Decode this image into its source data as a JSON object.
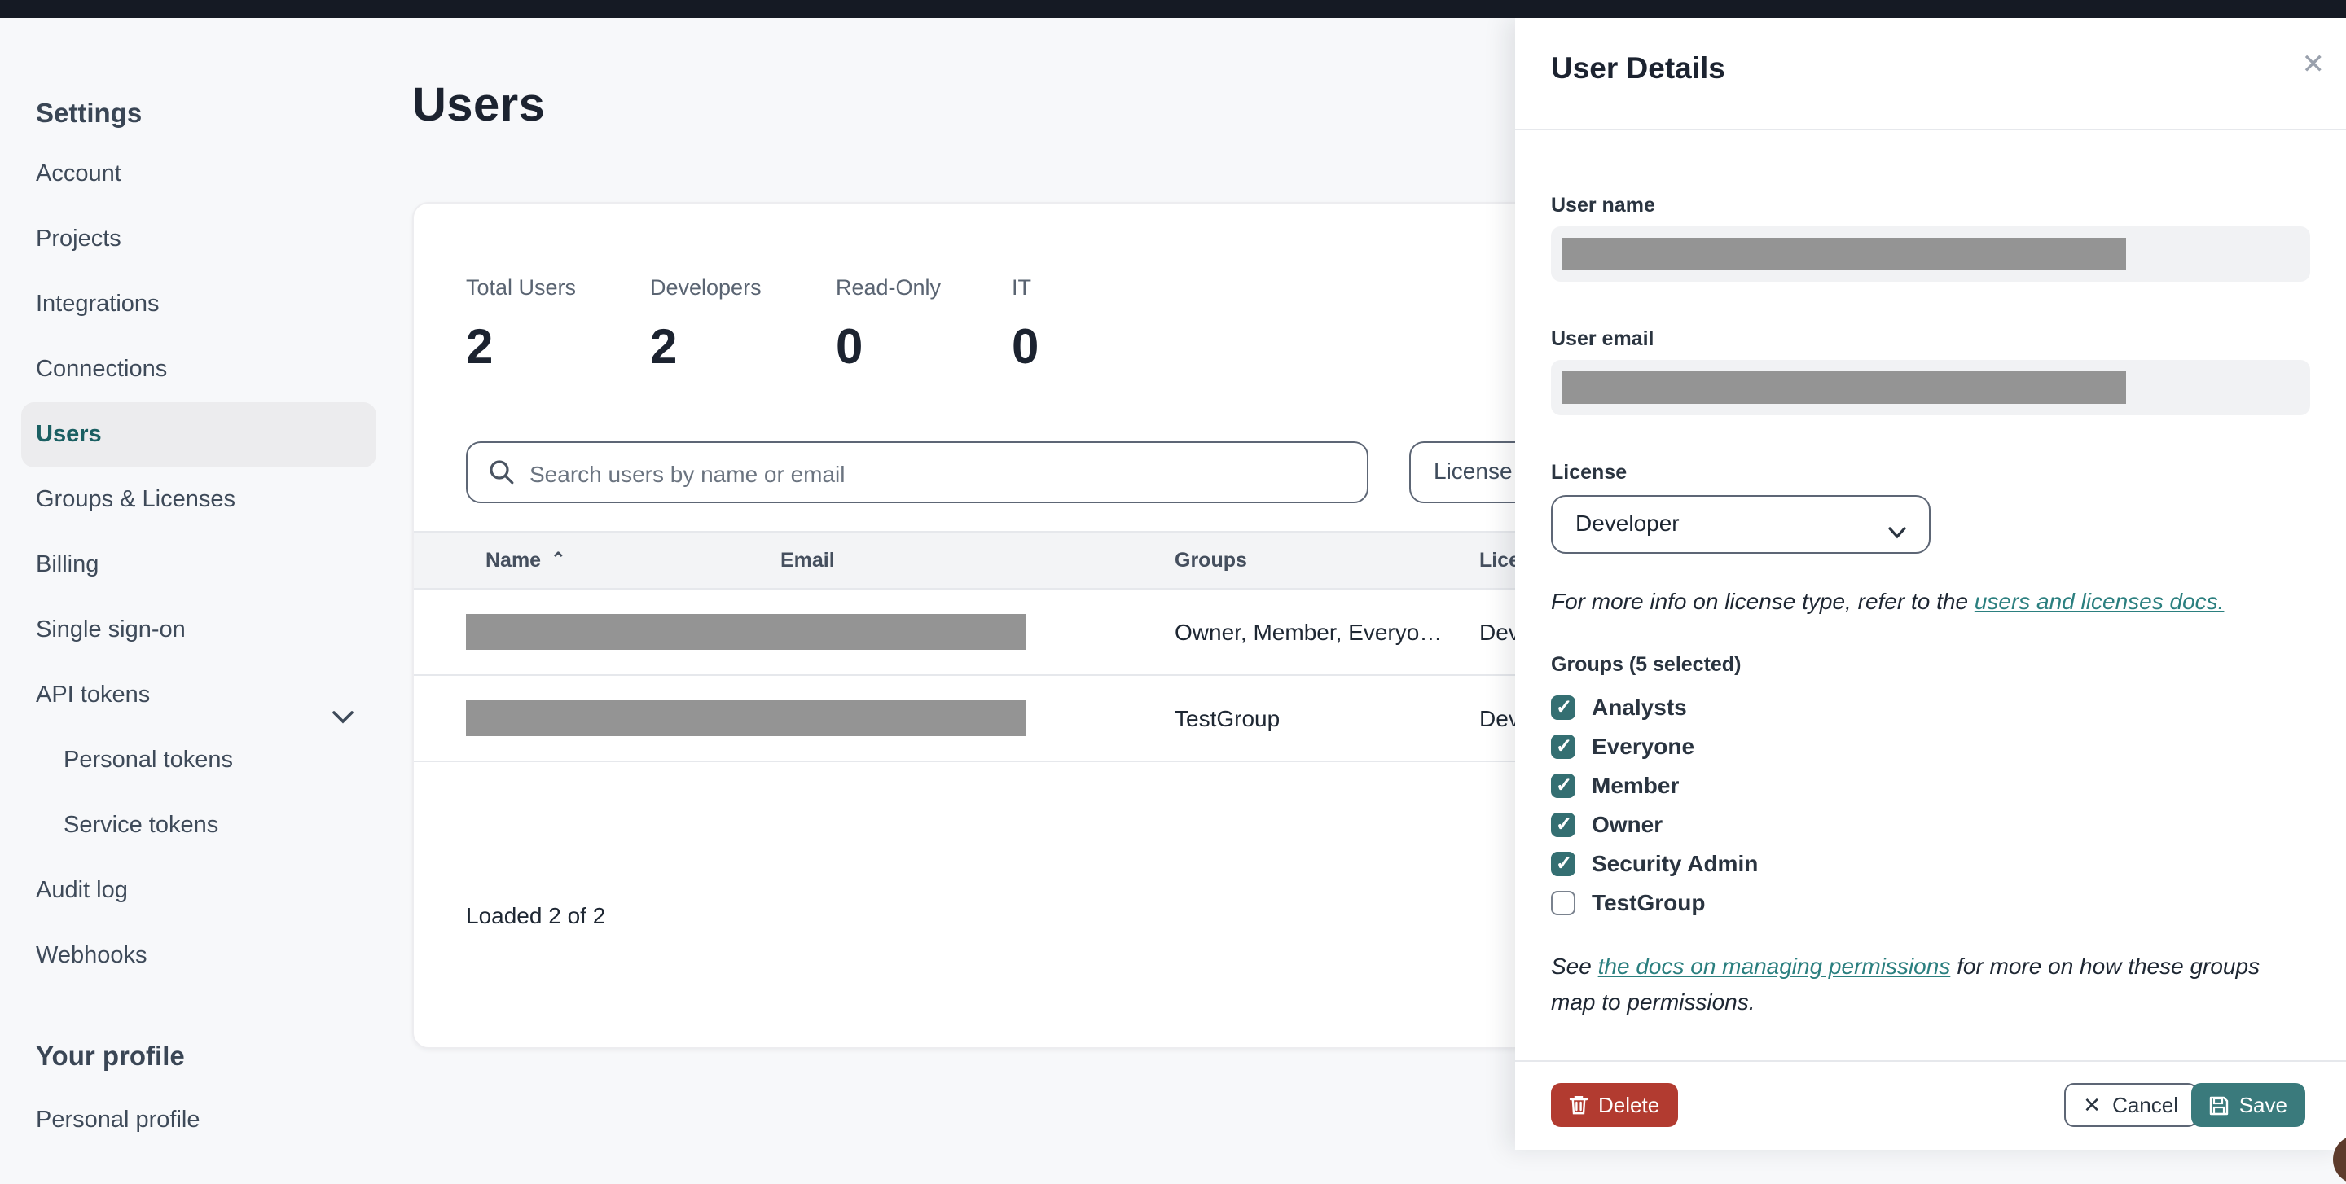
{
  "sidebar": {
    "section_title": "Settings",
    "items": [
      {
        "label": "Account"
      },
      {
        "label": "Projects"
      },
      {
        "label": "Integrations"
      },
      {
        "label": "Connections"
      },
      {
        "label": "Users",
        "active": true
      },
      {
        "label": "Groups & Licenses"
      },
      {
        "label": "Billing"
      },
      {
        "label": "Single sign-on"
      },
      {
        "label": "API tokens",
        "expandable": true
      },
      {
        "label": "Personal tokens",
        "sub": true
      },
      {
        "label": "Service tokens",
        "sub": true
      },
      {
        "label": "Audit log"
      },
      {
        "label": "Webhooks"
      }
    ],
    "profile_section_title": "Your profile",
    "profile_item": "Personal profile"
  },
  "main": {
    "title": "Users",
    "stats": [
      {
        "label": "Total Users",
        "value": "2"
      },
      {
        "label": "Developers",
        "value": "2"
      },
      {
        "label": "Read-Only",
        "value": "0"
      },
      {
        "label": "IT",
        "value": "0"
      }
    ],
    "search_placeholder": "Search users by name or email",
    "license_filter_label": "License",
    "table": {
      "columns": [
        "Name",
        "Email",
        "Groups",
        "License"
      ],
      "rows": [
        {
          "groups": "Owner, Member, Everyo…",
          "license": "Developer"
        },
        {
          "groups": "TestGroup",
          "license": "Developer"
        }
      ]
    },
    "loaded_text": "Loaded 2 of 2"
  },
  "panel": {
    "title": "User Details",
    "user_name_label": "User name",
    "user_email_label": "User email",
    "license_label": "License",
    "license_value": "Developer",
    "license_info": {
      "prefix": "For more info on license type, refer to the ",
      "link": "users and licenses docs."
    },
    "groups": {
      "label": "Groups (5 selected)",
      "options": [
        {
          "label": "Analysts",
          "checked": true
        },
        {
          "label": "Everyone",
          "checked": true
        },
        {
          "label": "Member",
          "checked": true
        },
        {
          "label": "Owner",
          "checked": true
        },
        {
          "label": "Security Admin",
          "checked": true
        },
        {
          "label": "TestGroup",
          "checked": false
        }
      ]
    },
    "permissions_note": {
      "prefix": "See ",
      "link": "the docs on managing permissions",
      "suffix": " for more on how these groups map to permissions."
    },
    "footer": {
      "delete_label": "Delete",
      "cancel_label": "Cancel",
      "save_label": "Save"
    }
  },
  "colors": {
    "accent_teal": "#346f72",
    "link_teal": "#2b7f7f",
    "delete_red": "#b23b30",
    "topbar": "#151a24",
    "redaction_gray": "#949494",
    "background": "#f7f8fa"
  }
}
